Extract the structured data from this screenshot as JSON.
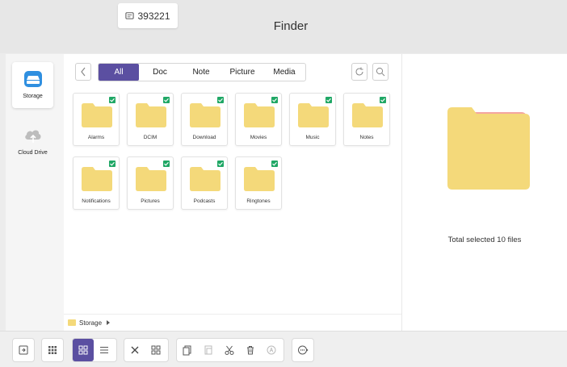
{
  "window": {
    "title": "Finder"
  },
  "badge": {
    "icon": "tag-icon",
    "text": "393221"
  },
  "sidebar": {
    "items": [
      {
        "label": "Storage",
        "icon": "storage-icon",
        "active": true
      },
      {
        "label": "Cloud Drive",
        "icon": "cloud-upload-icon",
        "active": false
      }
    ]
  },
  "toolbar": {
    "back_icon": "chevron-left-icon",
    "tabs": [
      {
        "label": "All",
        "active": true
      },
      {
        "label": "Doc",
        "active": false
      },
      {
        "label": "Note",
        "active": false
      },
      {
        "label": "Picture",
        "active": false
      },
      {
        "label": "Media",
        "active": false
      }
    ],
    "refresh_icon": "refresh-icon",
    "search_icon": "search-icon"
  },
  "folders": [
    {
      "name": "Alarms",
      "checked": true
    },
    {
      "name": "DCIM",
      "checked": true
    },
    {
      "name": "Download",
      "checked": true
    },
    {
      "name": "Movies",
      "checked": true
    },
    {
      "name": "Music",
      "checked": true
    },
    {
      "name": "Notes",
      "checked": true
    },
    {
      "name": "Notifications",
      "checked": true
    },
    {
      "name": "Pictures",
      "checked": true
    },
    {
      "name": "Podcasts",
      "checked": true
    },
    {
      "name": "Ringtones",
      "checked": true
    }
  ],
  "breadcrumb": {
    "label": "Storage"
  },
  "preview": {
    "info": "Total selected 10 files"
  },
  "colors": {
    "accent": "#5b4fa1",
    "folder": "#f4d97a",
    "check": "#1fa765",
    "background": "#ececec"
  },
  "bottombar": {
    "buttons": [
      "exit-icon",
      "qr-grid-icon",
      "grid-view-icon",
      "list-view-icon",
      "close-icon",
      "select-all-icon",
      "copy-icon",
      "paste-icon",
      "cut-icon",
      "delete-icon",
      "rename-icon",
      "more-icon"
    ]
  }
}
